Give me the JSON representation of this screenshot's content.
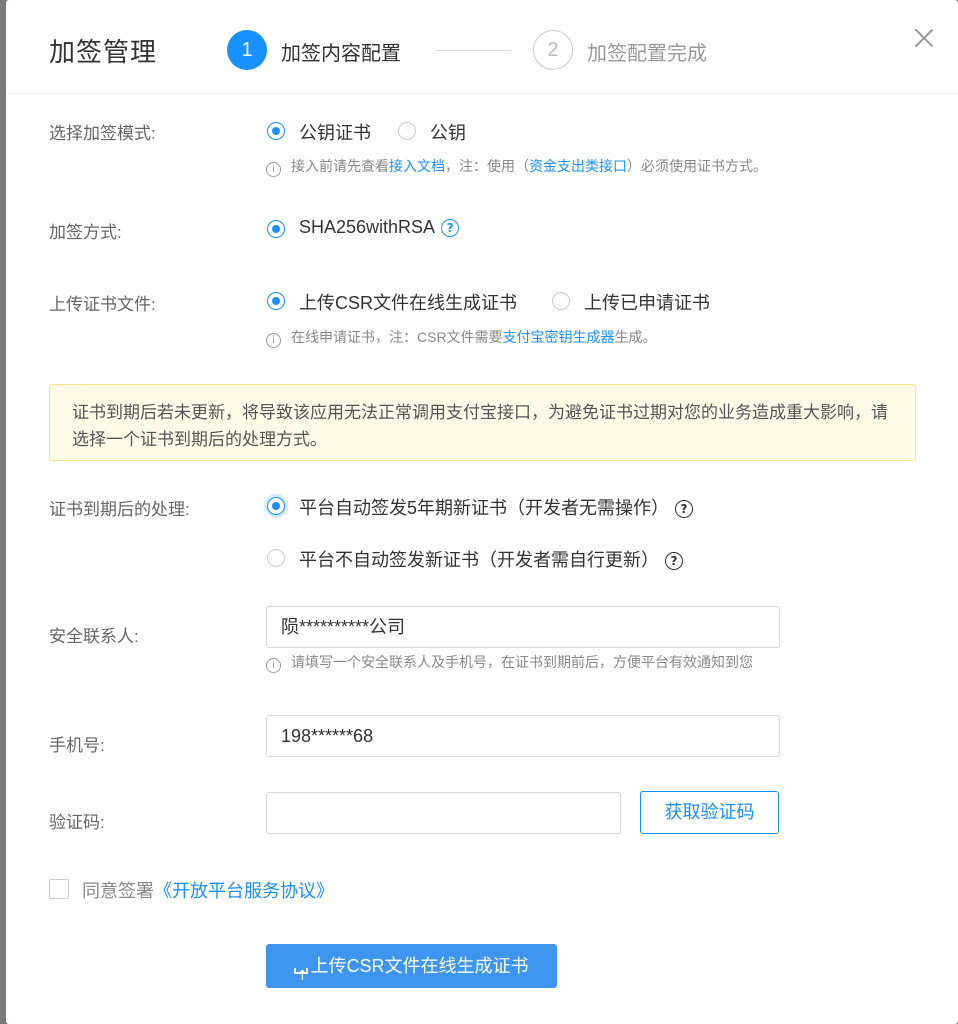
{
  "dialog": {
    "title": "加签管理",
    "steps": [
      {
        "num": "1",
        "label": "加签内容配置",
        "active": true
      },
      {
        "num": "2",
        "label": "加签配置完成",
        "active": false
      }
    ],
    "close_icon": "close-icon"
  },
  "sign_mode": {
    "label": "选择加签模式:",
    "options": [
      "公钥证书",
      "公钥"
    ],
    "selected": "公钥证书",
    "hint": {
      "prefix": "接入前请先查看",
      "link1": "接入文档",
      "middle": "，注：使用（",
      "link2": "资金支出类接口",
      "suffix": "）必须使用证书方式。"
    }
  },
  "sign_method": {
    "label": "加签方式:",
    "option": "SHA256withRSA"
  },
  "upload_cert": {
    "label": "上传证书文件:",
    "options": [
      "上传CSR文件在线生成证书",
      "上传已申请证书"
    ],
    "selected": "上传CSR文件在线生成证书",
    "hint": {
      "prefix": "在线申请证书，注：CSR文件需要",
      "link": "支付宝密钥生成器",
      "suffix": "生成。"
    }
  },
  "notice": "证书到期后若未更新，将导致该应用无法正常调用支付宝接口，为避免证书过期对您的业务造成重大影响，请选择一个证书到期后的处理方式。",
  "expiry": {
    "label": "证书到期后的处理:",
    "options": [
      "平台自动签发5年期新证书（开发者无需操作）",
      "平台不自动签发新证书（开发者需自行更新）"
    ],
    "selected": "平台自动签发5年期新证书（开发者无需操作）"
  },
  "contact": {
    "label": "安全联系人:",
    "value": "陨**********公司",
    "hint": "请填写一个安全联系人及手机号，在证书到期前后，方便平台有效通知到您"
  },
  "phone": {
    "label": "手机号:",
    "value": "198******68"
  },
  "code": {
    "label": "验证码:",
    "value": "",
    "button": "获取验证码"
  },
  "agreement": {
    "text": "同意签署",
    "link": "《开放平台服务协议》",
    "checked": false
  },
  "submit": {
    "label": "上传CSR文件在线生成证书"
  },
  "colors": {
    "accent": "#1890ff",
    "notice_bg": "#fffbe6",
    "notice_border": "#ffe58f"
  }
}
